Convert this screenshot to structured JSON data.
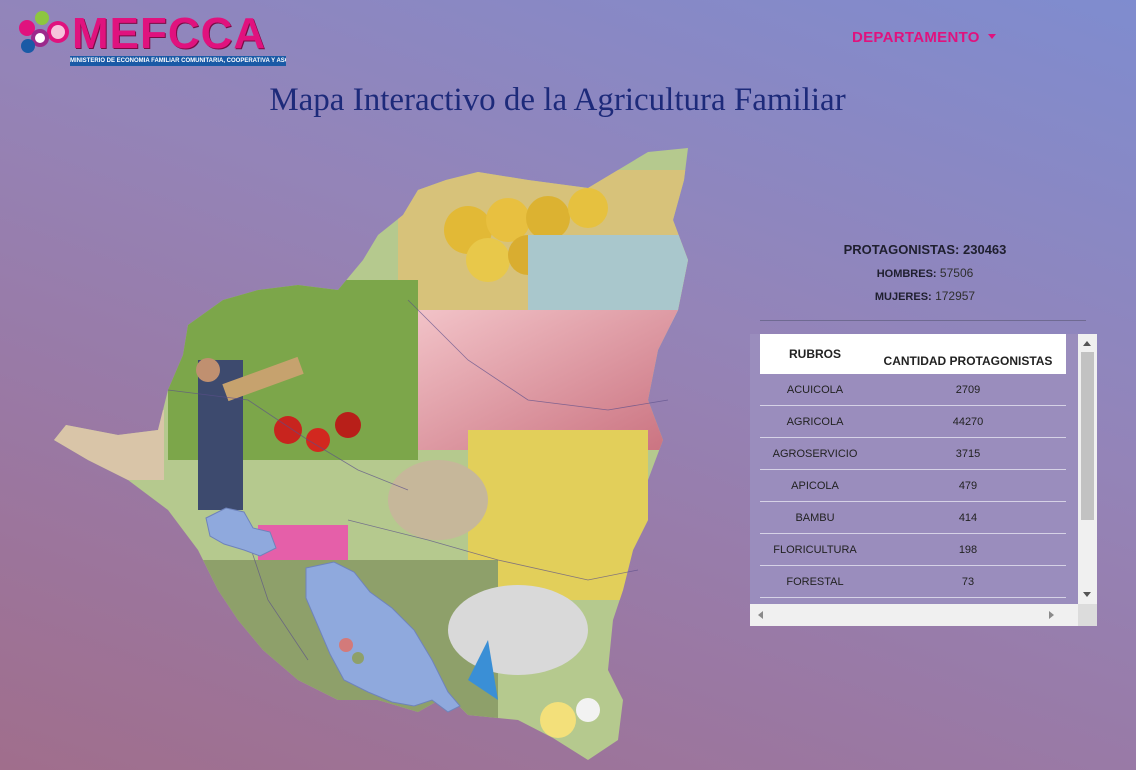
{
  "logo": {
    "text": "MEFCCA",
    "subtitle": "MINISTERIO DE ECONOMIA FAMILIAR COMUNITARIA, COOPERATIVA Y ASOCIATIVA",
    "brand_color": "#e0127e"
  },
  "nav": {
    "departamento_label": "DEPARTAMENTO"
  },
  "title": "Mapa Interactivo de la Agricultura Familiar",
  "stats": {
    "protagonistas_label": "PROTAGONISTAS:",
    "protagonistas_value": "230463",
    "hombres_label": "HOMBRES:",
    "hombres_value": "57506",
    "mujeres_label": "MUJERES:",
    "mujeres_value": "172957"
  },
  "table": {
    "headers": [
      "RUBROS",
      "CANTIDAD PROTAGONISTAS"
    ],
    "rows": [
      [
        "ACUICOLA",
        "2709"
      ],
      [
        "AGRICOLA",
        "44270"
      ],
      [
        "AGROSERVICIO",
        "3715"
      ],
      [
        "APICOLA",
        "479"
      ],
      [
        "BAMBU",
        "414"
      ],
      [
        "FLORICULTURA",
        "198"
      ],
      [
        "FORESTAL",
        "73"
      ],
      [
        "",
        ""
      ]
    ]
  }
}
